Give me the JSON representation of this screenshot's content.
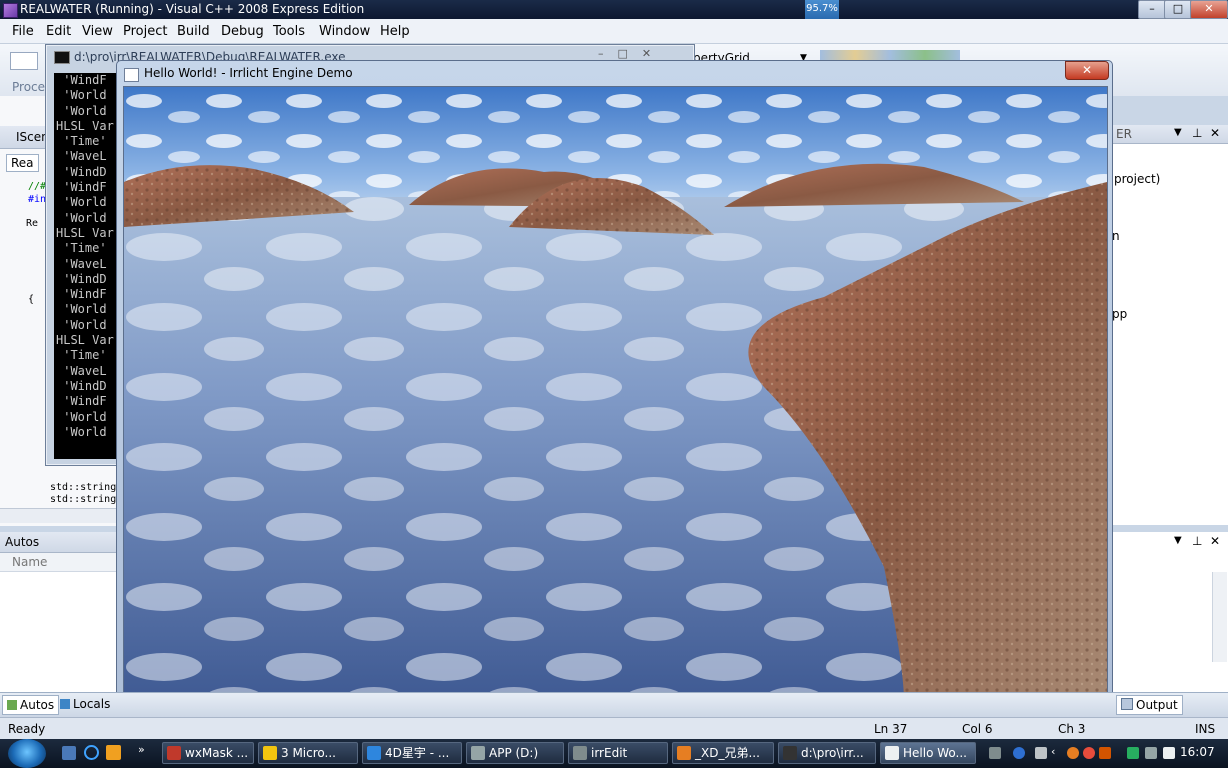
{
  "window": {
    "title": "REALWATER (Running) - Visual C++ 2008 Express Edition",
    "percent": "95.7%"
  },
  "menu": [
    "File",
    "Edit",
    "View",
    "Project",
    "Build",
    "Debug",
    "Tools",
    "Window",
    "Help"
  ],
  "toolbar": {
    "property_grid": "pertyGrid",
    "process_label": "Proce"
  },
  "console": {
    "title": "d:\\pro\\irr\\REALWATER\\Debug\\REALWATER.exe",
    "lines": [
      " 'WindF",
      " 'World",
      " 'World",
      "HLSL Var",
      " 'Time'",
      " 'WaveL",
      " 'WindD",
      " 'WindF",
      " 'World",
      " 'World",
      "HLSL Var",
      " 'Time'",
      " 'WaveL",
      " 'WindD",
      " 'WindF",
      " 'World",
      " 'World",
      "HLSL Var",
      " 'Time'",
      " 'WaveL",
      " 'WindD",
      " 'WindF",
      " 'World",
      " 'World"
    ]
  },
  "editor": {
    "tab": "IScen",
    "subtab": "Rea",
    "code_lines": [
      "//#",
      "#in",
      "Re",
      "{"
    ],
    "bottom_code": [
      "std::string",
      "std::string"
    ]
  },
  "irrlicht": {
    "title": "Hello World! - Irrlicht Engine Demo"
  },
  "right_pane": {
    "header": "ER",
    "items": [
      "project)",
      "n",
      "pp"
    ]
  },
  "autos": {
    "title": "Autos",
    "column": "Name"
  },
  "bottom_tabs": {
    "autos": "Autos",
    "locals": "Locals",
    "output": "Output"
  },
  "status": {
    "ready": "Ready",
    "ln": "Ln 37",
    "col": "Col 6",
    "ch": "Ch 3",
    "ins": "INS"
  },
  "taskbar": {
    "items": [
      {
        "label": "wxMask ...",
        "color": "#c0392b"
      },
      {
        "label": "3 Micro...",
        "color": "#f1c40f"
      },
      {
        "label": "4D星宇 - ...",
        "color": "#2e86de"
      },
      {
        "label": "APP (D:)",
        "color": "#95a5a6"
      },
      {
        "label": "irrEdit",
        "color": "#7f8c8d"
      },
      {
        "label": "_XD_兄弟...",
        "color": "#e67e22"
      },
      {
        "label": "d:\\pro\\irr...",
        "color": "#333333"
      },
      {
        "label": "Hello Wo...",
        "color": "#ecf0f1"
      }
    ],
    "clock": "16:07"
  }
}
